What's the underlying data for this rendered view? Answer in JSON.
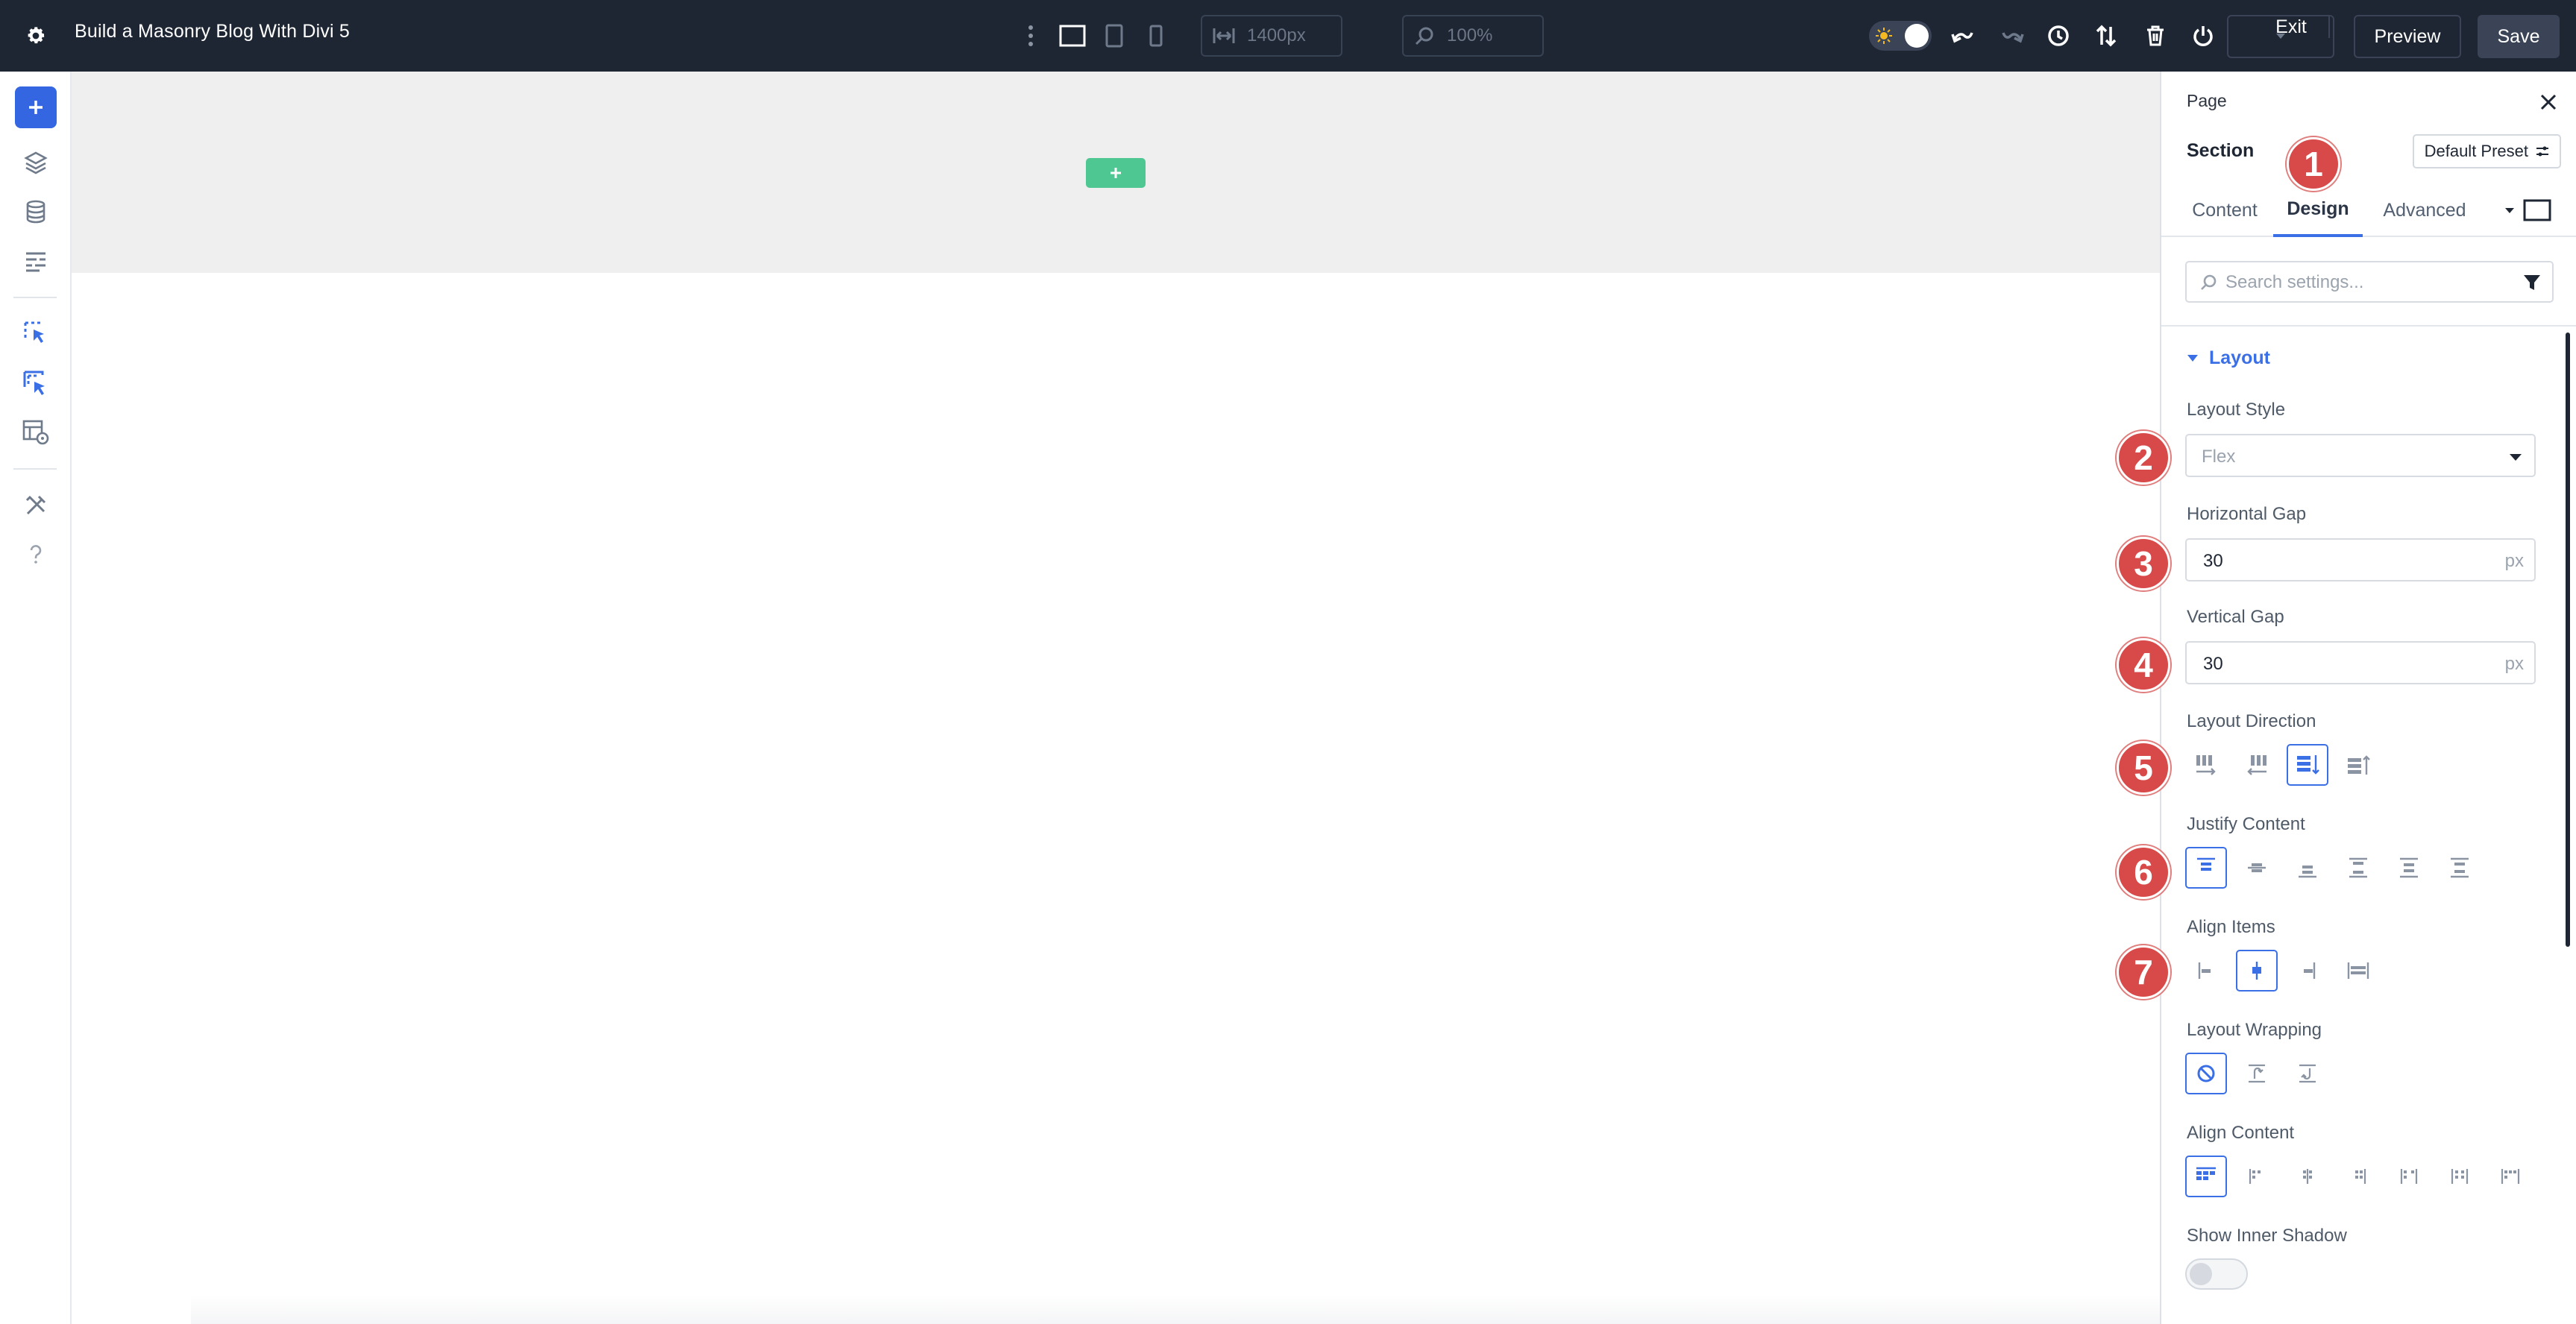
{
  "topbar": {
    "title": "Build a Masonry Blog With Divi 5",
    "width_value": "1400px",
    "zoom_value": "100%",
    "exit_label": "Exit",
    "preview_label": "Preview",
    "save_label": "Save",
    "icons": [
      "gear-icon",
      "kebab-icon",
      "desktop-view-icon",
      "tablet-view-icon",
      "phone-view-icon",
      "width-icon",
      "zoom-icon",
      "theme-toggle",
      "undo-icon",
      "redo-icon",
      "history-icon",
      "portability-icon",
      "delete-icon",
      "power-icon"
    ]
  },
  "rail": {
    "icons": [
      "add-icon",
      "layers-icon",
      "database-icon",
      "wireframe-icon",
      "select-icon",
      "multi-select-icon",
      "layout-settings-icon",
      "tools-icon",
      "help-icon"
    ]
  },
  "canvas": {
    "section_color": "#efefef",
    "add_row_color": "#4fc792"
  },
  "panel": {
    "breadcrumb": "Page",
    "element": "Section",
    "preset": "Default Preset",
    "tabs": [
      {
        "label": "Content",
        "active": false
      },
      {
        "label": "Design",
        "active": true
      },
      {
        "label": "Advanced",
        "active": false
      }
    ],
    "search_placeholder": "Search settings...",
    "group_title": "Layout",
    "fields": {
      "layout_style": {
        "label": "Layout Style",
        "value": "Flex"
      },
      "horizontal_gap": {
        "label": "Horizontal Gap",
        "value": "30",
        "unit": "px"
      },
      "vertical_gap": {
        "label": "Vertical Gap",
        "value": "30",
        "unit": "px"
      },
      "layout_direction": {
        "label": "Layout Direction",
        "options": 4,
        "selected": 3
      },
      "justify_content": {
        "label": "Justify Content",
        "options": 6,
        "selected": 1
      },
      "align_items": {
        "label": "Align Items",
        "options": 4,
        "selected": 2
      },
      "layout_wrapping": {
        "label": "Layout Wrapping",
        "options": 3,
        "selected": 1
      },
      "align_content": {
        "label": "Align Content",
        "options": 7,
        "selected": 1
      },
      "show_inner_shadow": {
        "label": "Show Inner Shadow",
        "on": false
      }
    }
  },
  "badges": [
    "1",
    "2",
    "3",
    "4",
    "5",
    "6",
    "7"
  ],
  "colors": {
    "accent": "#3b6fe6",
    "topbar": "#1e2633",
    "badge": "#d84a49"
  }
}
